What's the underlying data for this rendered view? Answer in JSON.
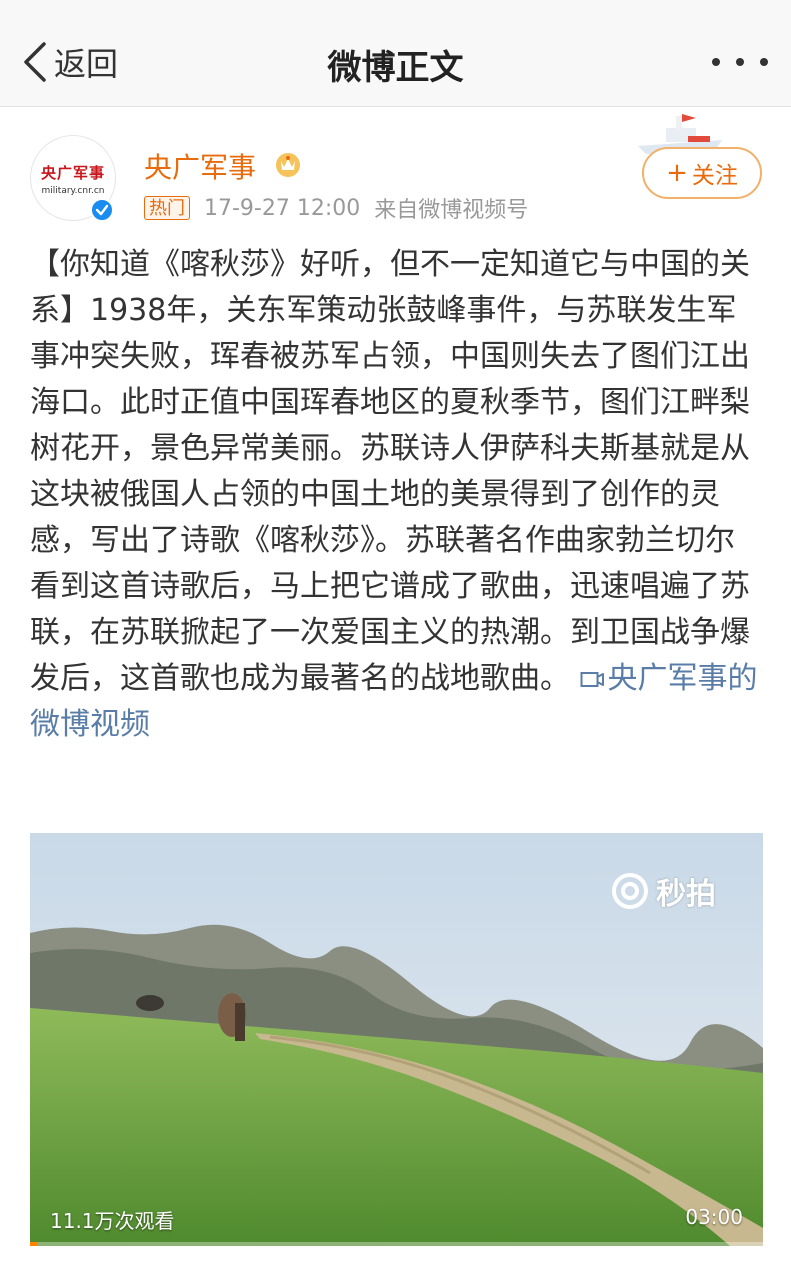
{
  "nav": {
    "back_label": "返回",
    "title": "微博正文"
  },
  "post": {
    "avatar": {
      "name_text": "央广军事",
      "site_text": "military.cnr.cn"
    },
    "username": "央广军事",
    "badge": "热门",
    "time": "17-9-27 12:00",
    "source": "来自微博视频号",
    "follow_label": "关注",
    "body_text": "【你知道《喀秋莎》好听，但不一定知道它与中国的关系】1938年，关东军策动张鼓峰事件，与苏联发生军事冲突失败，珲春被苏军占领，中国则失去了图们江出海口。此时正值中国珲春地区的夏秋季节，图们江畔梨树花开，景色异常美丽。苏联诗人伊萨科夫斯基就是从这块被俄国人占领的中国土地的美景得到了创作的灵感，写出了诗歌《喀秋莎》。苏联著名作曲家勃兰切尔看到这首诗歌后，马上把它谱成了歌曲，迅速唱遍了苏联，在苏联掀起了一次爱国主义的热潮。到卫国战争爆发后，这首歌也成为最著名的战地歌曲。",
    "video_link": "央广军事的微博视频"
  },
  "video": {
    "watermark": "秒拍",
    "views": "11.1万次观看",
    "duration": "03:00",
    "progress": 0.01
  },
  "colors": {
    "accent_orange": "#e86b0e",
    "link_blue": "#5a7da8",
    "verify_blue": "#1a8cf0"
  },
  "icons": [
    "back-chevron-icon",
    "more-dots-icon",
    "verified-icon",
    "member-crown-icon",
    "video-link-icon",
    "camera-watermark-icon"
  ]
}
